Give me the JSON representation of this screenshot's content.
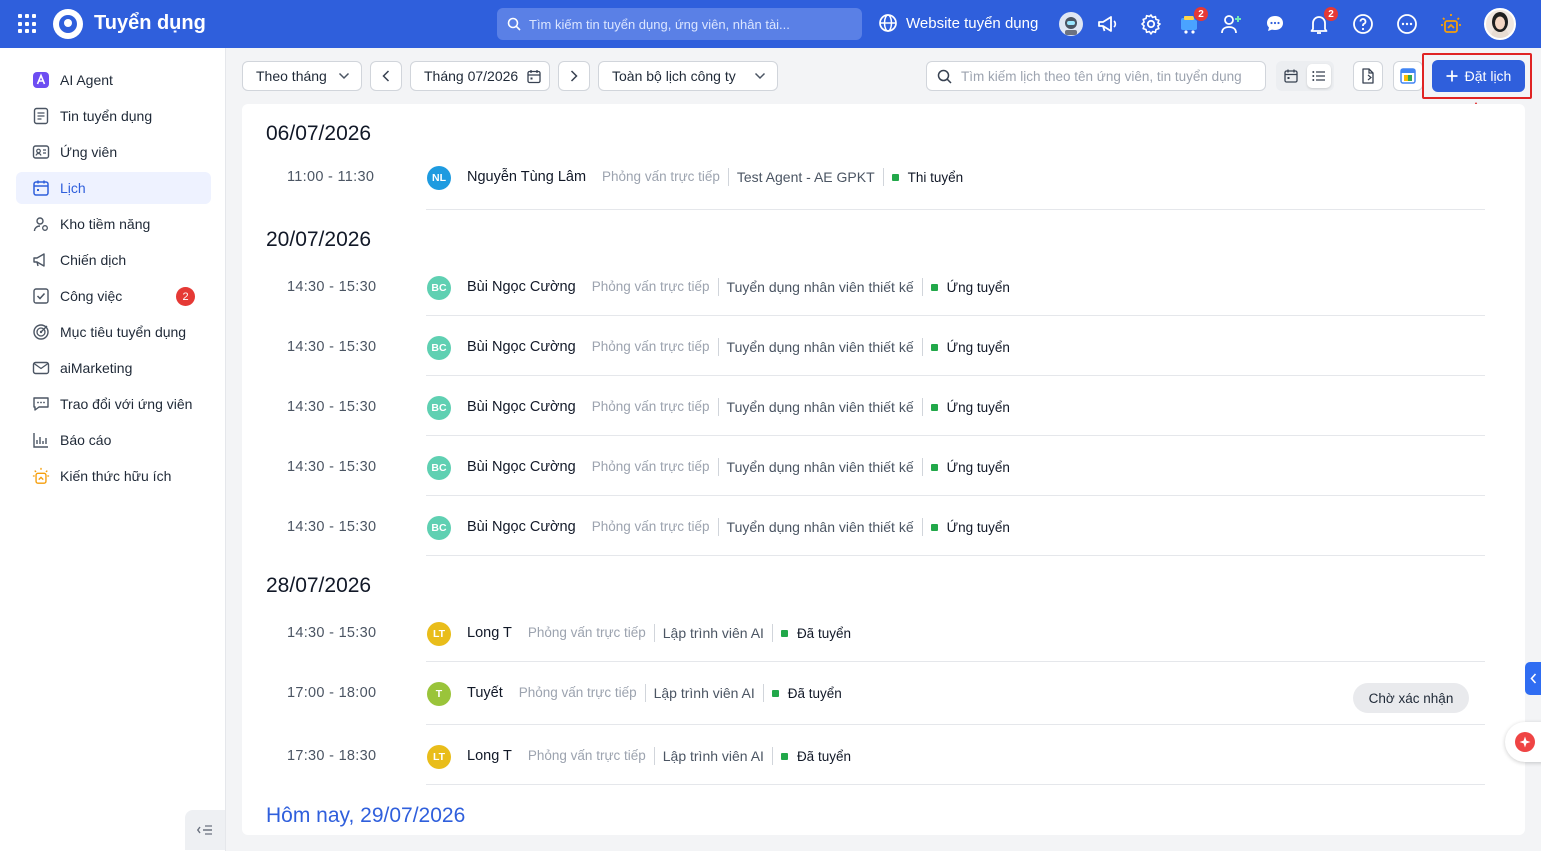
{
  "header": {
    "app_title": "Tuyển dụng",
    "search_placeholder": "Tìm kiếm tin tuyển dụng, ứng viên, nhân tài...",
    "website_label": "Website tuyển dụng",
    "cart_badge": "2",
    "notification_badge": "2"
  },
  "sidebar": {
    "items": [
      {
        "label": "AI Agent",
        "icon": "ai-agent-icon"
      },
      {
        "label": "Tin tuyển dụng",
        "icon": "job-post-icon"
      },
      {
        "label": "Ứng viên",
        "icon": "candidate-icon"
      },
      {
        "label": "Lịch",
        "icon": "calendar-icon",
        "active": true
      },
      {
        "label": "Kho tiềm năng",
        "icon": "talent-pool-icon"
      },
      {
        "label": "Chiến dịch",
        "icon": "campaign-icon"
      },
      {
        "label": "Công việc",
        "icon": "task-icon",
        "badge": "2"
      },
      {
        "label": "Mục tiêu tuyển dụng",
        "icon": "target-icon"
      },
      {
        "label": "aiMarketing",
        "icon": "mail-icon"
      },
      {
        "label": "Trao đổi với ứng viên",
        "icon": "chat-icon"
      },
      {
        "label": "Báo cáo",
        "icon": "report-icon"
      },
      {
        "label": "Kiến thức hữu ích",
        "icon": "knowledge-icon"
      }
    ]
  },
  "toolbar": {
    "view_mode": "Theo tháng",
    "month": "Tháng 07/2026",
    "scope": "Toàn bộ lịch công ty",
    "search_placeholder": "Tìm kiếm lịch theo tên ứng viên, tin tuyển dụng",
    "add_button": "Đặt lịch"
  },
  "schedule": {
    "days": [
      {
        "date": "06/07/2026",
        "events": [
          {
            "time": "11:00 - 11:30",
            "initials": "NL",
            "avatar_color": "#1e9be0",
            "name": "Nguyễn Tùng Lâm",
            "type": "Phỏng vấn trực tiếp",
            "job": "Test Agent - AE GPKT",
            "status": "Thi tuyển"
          }
        ]
      },
      {
        "date": "20/07/2026",
        "events": [
          {
            "time": "14:30 - 15:30",
            "initials": "BC",
            "avatar_color": "#5fd0b2",
            "name": "Bùi Ngọc Cường",
            "type": "Phỏng vấn trực tiếp",
            "job": "Tuyển dụng nhân viên thiết kế",
            "status": "Ứng tuyển"
          },
          {
            "time": "14:30 - 15:30",
            "initials": "BC",
            "avatar_color": "#5fd0b2",
            "name": "Bùi Ngọc Cường",
            "type": "Phỏng vấn trực tiếp",
            "job": "Tuyển dụng nhân viên thiết kế",
            "status": "Ứng tuyển"
          },
          {
            "time": "14:30 - 15:30",
            "initials": "BC",
            "avatar_color": "#5fd0b2",
            "name": "Bùi Ngọc Cường",
            "type": "Phỏng vấn trực tiếp",
            "job": "Tuyển dụng nhân viên thiết kế",
            "status": "Ứng tuyển"
          },
          {
            "time": "14:30 - 15:30",
            "initials": "BC",
            "avatar_color": "#5fd0b2",
            "name": "Bùi Ngọc Cường",
            "type": "Phỏng vấn trực tiếp",
            "job": "Tuyển dụng nhân viên thiết kế",
            "status": "Ứng tuyển"
          },
          {
            "time": "14:30 - 15:30",
            "initials": "BC",
            "avatar_color": "#5fd0b2",
            "name": "Bùi Ngọc Cường",
            "type": "Phỏng vấn trực tiếp",
            "job": "Tuyển dụng nhân viên thiết kế",
            "status": "Ứng tuyển"
          }
        ]
      },
      {
        "date": "28/07/2026",
        "events": [
          {
            "time": "14:30 - 15:30",
            "initials": "LT",
            "avatar_color": "#e9bd1a",
            "name": "Long T",
            "type": "Phỏng vấn trực tiếp",
            "job": "Lập trình viên AI",
            "status": "Đã tuyển"
          },
          {
            "time": "17:00 - 18:00",
            "initials": "T",
            "avatar_color": "#9ac43a",
            "name": "Tuyết",
            "type": "Phỏng vấn trực tiếp",
            "job": "Lập trình viên AI",
            "status": "Đã tuyển",
            "pill": "Chờ xác nhận"
          },
          {
            "time": "17:30 - 18:30",
            "initials": "LT",
            "avatar_color": "#e9bd1a",
            "name": "Long T",
            "type": "Phỏng vấn trực tiếp",
            "job": "Lập trình viên AI",
            "status": "Đã tuyển"
          }
        ]
      }
    ],
    "today_label": "Hôm nay, 29/07/2026"
  },
  "colors": {
    "brand": "#2f5fdc",
    "status_green": "#22a84a",
    "highlight_red": "#e02424"
  }
}
